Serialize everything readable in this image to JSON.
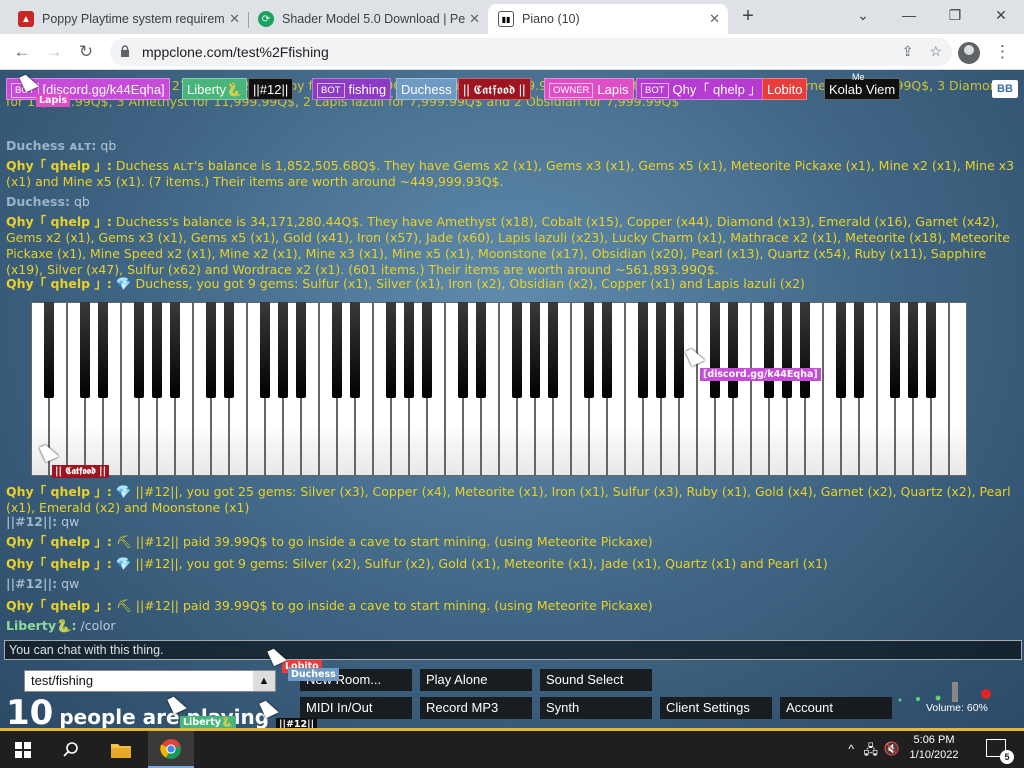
{
  "browser": {
    "tabs": [
      {
        "title": "Poppy Playtime system requirem",
        "active": false
      },
      {
        "title": "Shader Model 5.0 Download | Pe",
        "active": false
      },
      {
        "title": "Piano (10)",
        "active": true
      }
    ],
    "url": "mppclone.com/test%2Ffishing"
  },
  "participants": [
    {
      "name": "[discord.gg/k44Eqha]",
      "tag": "BOT",
      "color": "#c74bd9"
    },
    {
      "name": "Liberty🐍",
      "tag": "",
      "color": "#49b57b"
    },
    {
      "name": "||#12||",
      "tag": "",
      "color": "#101010"
    },
    {
      "name": "fishing",
      "tag": "BOT",
      "color": "#8d3ac4"
    },
    {
      "name": "Duchess",
      "tag": "",
      "color": "#6f9ac4"
    },
    {
      "name": "|| 𝕮𝖆𝖙𝖋𝖔𝖔𝖉 ||",
      "tag": "",
      "color": "#9c1520"
    },
    {
      "name": "Lapis",
      "tag": "OWNER",
      "color": "#e04ec5"
    },
    {
      "name": "Qhy「 qhelp 」",
      "tag": "BOT",
      "color": "#b53bd1"
    },
    {
      "name": "Lobito",
      "tag": "",
      "color": "#e83d3d"
    },
    {
      "name": "Kolab Viem",
      "tag": "",
      "color": "#101010"
    }
  ],
  "participant_extra": {
    "me_label": "Me",
    "bb_label": "BB",
    "lapis_cursor": "Lapis"
  },
  "chat": [
    {
      "name": "",
      "text": "...99.99Q$, 7 Sapphire for 27,999.99Q$, 5 Ruby for 11,999.99Q$, 5 Topaz for 11,999.99Q$, 7 Moonstone for 27,999.99Q$, 7 Garnet for 5,599.99Q$, 3 Diamond for 15,999.99Q$, 3 Amethyst for 11,999.99Q$, 2 Lapis lazuli for 7,999.99Q$ and 2 Obsidian for 7,999.99Q$",
      "nclass": "qhy",
      "bclass": "body-y"
    },
    {
      "name": "Duchess ᴀʟᴛ:",
      "text": "qb",
      "nclass": "duch",
      "bclass": "body-g"
    },
    {
      "name": "Qhy「 qhelp 」:",
      "text": "Duchess ᴀʟᴛ's balance is 1,852,505.68Q$. They have Gems x2 (x1), Gems x3 (x1), Gems x5 (x1), Meteorite Pickaxe (x1), Mine x2 (x1), Mine x3 (x1) and Mine x5 (x1). (7 items.) Their items are worth around ~449,999.93Q$.",
      "nclass": "qhy",
      "bclass": "body-y"
    },
    {
      "name": "Duchess:",
      "text": "qb",
      "nclass": "duch",
      "bclass": "body-g"
    },
    {
      "name": "Qhy「 qhelp 」:",
      "text": "Duchess's balance is 34,171,280.44Q$. They have Amethyst (x18), Cobalt (x15), Copper (x44), Diamond (x13), Emerald (x16), Garnet (x42), Gems x2 (x1), Gems x3 (x1), Gems x5 (x1), Gold (x41), Iron (x57), Jade (x60), Lapis lazuli (x23), Lucky Charm (x1), Mathrace x2 (x1), Meteorite (x18), Meteorite Pickaxe (x1), Mine Speed x2 (x1), Mine x2 (x1), Mine x3 (x1), Mine x5 (x1), Moonstone (x17), Obsidian (x20), Pearl (x13), Quartz (x54), Ruby (x11), Sapphire (x19), Silver (x47), Sulfur (x62) and Wordrace x2 (x1). (601 items.) Their items are worth around ~561,893.99Q$.",
      "nclass": "qhy",
      "bclass": "body-y"
    },
    {
      "name": "Qhy「 qhelp 」:",
      "text": "💎 Duchess, you got 9 gems: Sulfur (x1), Silver (x1), Iron (x2), Obsidian (x2), Copper (x1) and Lapis lazuli (x2)",
      "nclass": "qhy",
      "bclass": "body-y"
    },
    {
      "name": "Qhy「 qhelp 」:",
      "text": "💎 ||#12||, you got 25 gems: Silver (x3), Copper (x4), Meteorite (x1), Iron (x1), Sulfur (x3), Ruby (x1), Gold (x4), Garnet (x2), Quartz (x2), Pearl (x1), Emerald (x2) and Moonstone (x1)",
      "nclass": "qhy",
      "bclass": "body-y"
    },
    {
      "name": "||#12||:",
      "text": "qw",
      "nclass": "twelve",
      "bclass": "body-g"
    },
    {
      "name": "Qhy「 qhelp 」:",
      "text": "⛏ ||#12|| paid 39.99Q$ to go inside a cave to start mining. (using Meteorite Pickaxe)",
      "nclass": "qhy",
      "bclass": "body-y"
    },
    {
      "name": "Qhy「 qhelp 」:",
      "text": "💎 ||#12||, you got 9 gems: Silver (x2), Sulfur (x2), Gold (x1), Meteorite (x1), Jade (x1), Quartz (x1) and Pearl (x1)",
      "nclass": "qhy",
      "bclass": "body-y"
    },
    {
      "name": "||#12||:",
      "text": "qw",
      "nclass": "twelve",
      "bclass": "body-g"
    },
    {
      "name": "Qhy「 qhelp 」:",
      "text": "⛏ ||#12|| paid 39.99Q$ to go inside a cave to start mining. (using Meteorite Pickaxe)",
      "nclass": "qhy",
      "bclass": "body-y"
    },
    {
      "name": "Liberty🐍:",
      "text": "/color",
      "nclass": "lib",
      "bclass": "body-g"
    }
  ],
  "piano_cursors": {
    "discord": "[discord.gg/k44Eqha]",
    "catfood": "|| 𝕮𝖆𝖙𝖋𝖔𝖔𝖉 ||",
    "lobito": "Lobito",
    "duchess": "Duchess",
    "liberty": "Liberty🐍",
    "twelve": "||#12||"
  },
  "chat_input_placeholder": "You can chat with this thing.",
  "room": {
    "value": "test/fishing"
  },
  "playing": {
    "count": "10",
    "text": "people are playing"
  },
  "buttons": {
    "new_room": "New Room...",
    "play_alone": "Play Alone",
    "sound_select": "Sound Select",
    "midi": "MIDI In/Out",
    "record": "Record MP3",
    "synth": "Synth",
    "client_settings": "Client Settings",
    "account": "Account"
  },
  "volume": {
    "label": "Volume: 60%",
    "level": 0.6
  },
  "clock": {
    "time": "5:06 PM",
    "date": "1/10/2022"
  },
  "notifications": "5"
}
